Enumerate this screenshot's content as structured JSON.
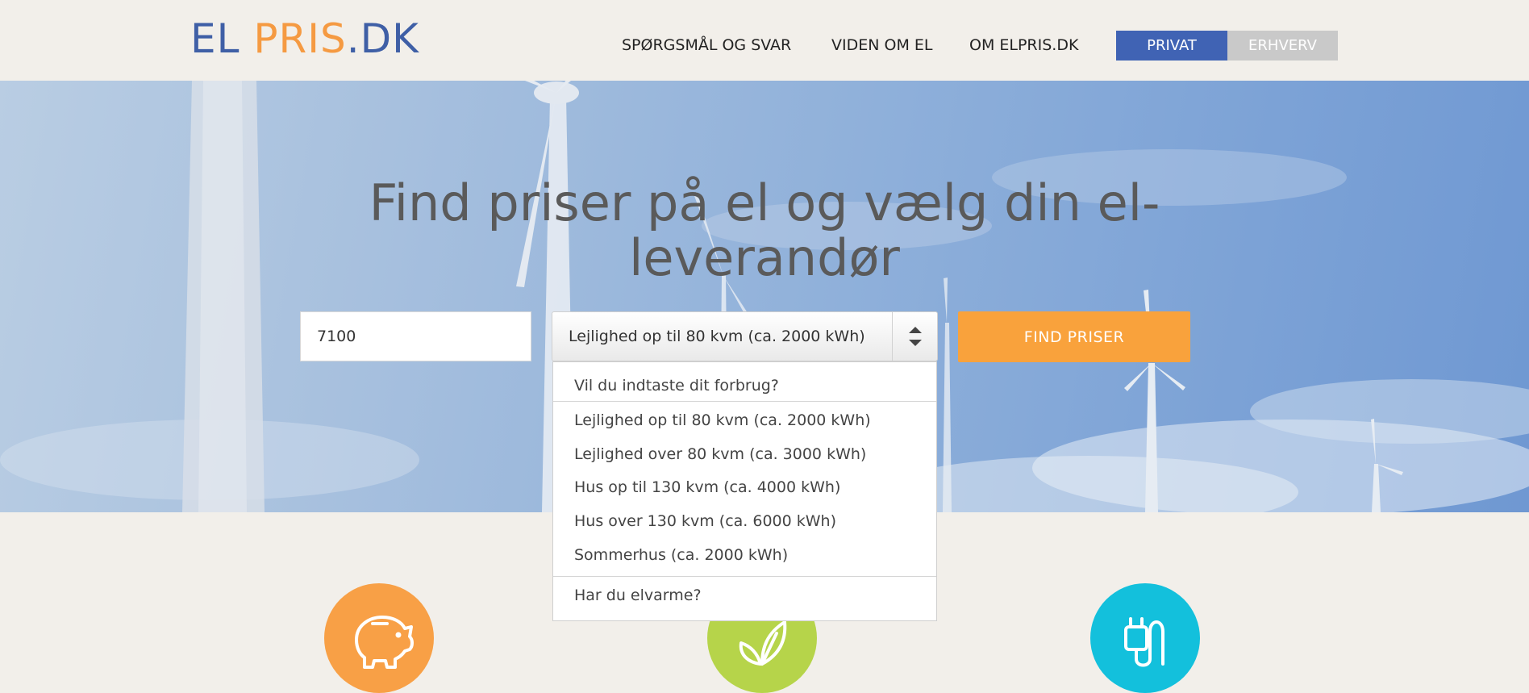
{
  "brand": {
    "logo_el": "EL",
    "logo_pris": "PRIS",
    "logo_dk": ".DK",
    "colors": {
      "blue": "#3f5fa6",
      "orange": "#f59a42"
    }
  },
  "nav": {
    "links": [
      "SPØRGSMÅL OG SVAR",
      "VIDEN OM EL",
      "OM ELPRIS.DK"
    ],
    "segment": {
      "privat": "PRIVAT",
      "erhverv": "ERHVERV",
      "active": "PRIVAT"
    }
  },
  "hero": {
    "headline": "Find priser på el og vælg din el-leverandør",
    "zip_value": "7100",
    "select_value": "Lejlighed op til 80 kvm (ca. 2000 kWh)",
    "find_button": "FIND PRISER",
    "find_button_color": "#f9a23c"
  },
  "dropdown": {
    "open": true,
    "header_option": "Vil du indtaste dit forbrug?",
    "options": [
      "Lejlighed op til 80 kvm (ca. 2000 kWh)",
      "Lejlighed over 80 kvm (ca. 3000 kWh)",
      "Hus op til 130 kvm (ca. 4000 kWh)",
      "Hus over 130 kvm (ca. 6000 kWh)",
      "Sommerhus (ca. 2000 kWh)"
    ],
    "footer_option": "Har du elvarme?"
  },
  "features": [
    {
      "icon": "piggy-bank-icon",
      "color": "#f8a046"
    },
    {
      "icon": "leaf-icon",
      "color": "#b6d44a"
    },
    {
      "icon": "plug-icon",
      "color": "#13c0dc"
    }
  ]
}
